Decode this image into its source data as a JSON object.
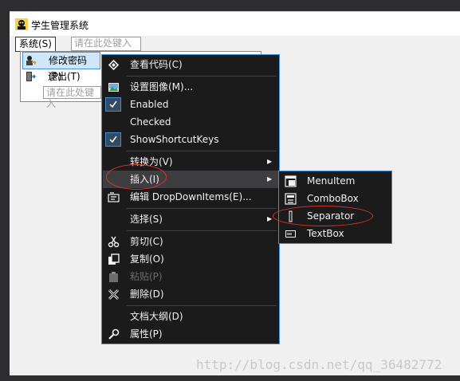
{
  "window": {
    "title": "学生管理系统"
  },
  "form_menu": {
    "system_menu": "系统(S)",
    "placeholder": "请在此处键入",
    "items": [
      {
        "label": "修改密码(P)",
        "icon": "key-user-icon"
      },
      {
        "label": "退出(T)",
        "icon": "exit-door-icon"
      }
    ],
    "sub_placeholder": "请在此处键入"
  },
  "context_menu": {
    "items": [
      {
        "label": "查看代码(C)",
        "icon": "code-view-icon"
      },
      {
        "label": "设置图像(M)...",
        "icon": "image-icon"
      },
      {
        "label": "Enabled",
        "checked": true
      },
      {
        "label": "Checked",
        "checked": false
      },
      {
        "label": "ShowShortcutKeys",
        "checked": true
      },
      {
        "label": "转换为(V)",
        "submenu": true
      },
      {
        "label": "插入(I)",
        "submenu": true,
        "highlighted": true
      },
      {
        "label": "编辑 DropDownItems(E)...",
        "icon": "edit-items-icon"
      },
      {
        "label": "选择(S)",
        "submenu": true
      },
      {
        "label": "剪切(C)",
        "icon": "scissors-icon"
      },
      {
        "label": "复制(O)",
        "icon": "copy-icon"
      },
      {
        "label": "粘贴(P)",
        "icon": "paste-icon",
        "disabled": true
      },
      {
        "label": "删除(D)",
        "icon": "delete-x-icon"
      },
      {
        "label": "文档大纲(D)"
      },
      {
        "label": "属性(P)",
        "icon": "wrench-icon"
      }
    ]
  },
  "insert_submenu": {
    "items": [
      {
        "label": "MenuItem",
        "icon": "menuitem-icon"
      },
      {
        "label": "ComboBox",
        "icon": "combobox-icon"
      },
      {
        "label": "Separator",
        "icon": "separator-icon"
      },
      {
        "label": "TextBox",
        "icon": "textbox-icon"
      }
    ]
  },
  "watermark": "http://blog.csdn.net/qq_36482772",
  "colors": {
    "menu_bg": "#1b1b1c",
    "menu_border": "#3f8ed8",
    "menu_text": "#f1f1f1",
    "hover_bg": "#3e3e40",
    "annotation": "#d9322e"
  }
}
